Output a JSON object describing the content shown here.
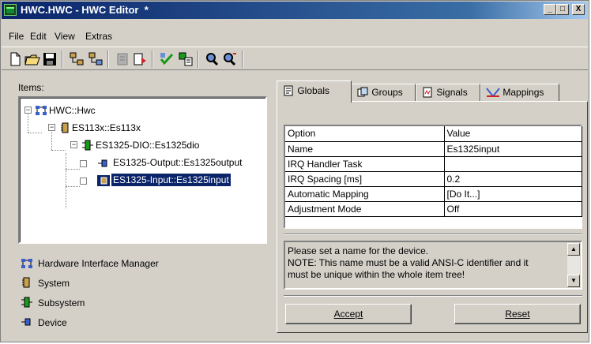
{
  "window": {
    "title": "HWC.HWC - HWC Editor  *",
    "minimize": "_",
    "maximize": "□",
    "close": "X"
  },
  "menu": [
    "File",
    "Edit",
    "View",
    "Extras"
  ],
  "left": {
    "items_label": "Items:",
    "tree": [
      {
        "label": "HWC::Hwc",
        "expander": "−",
        "icon": "hardware-manager-icon"
      },
      {
        "label": "ES113x::Es113x",
        "expander": "−",
        "icon": "system-icon"
      },
      {
        "label": "ES1325-DIO::Es1325dio",
        "expander": "−",
        "icon": "subsystem-icon"
      },
      {
        "label": "ES1325-Output::Es1325output",
        "expander": "",
        "icon": "device-icon"
      },
      {
        "label": "ES1325-Input::Es1325input",
        "expander": "",
        "icon": "device-icon"
      }
    ],
    "legend": [
      {
        "label": "Hardware Interface Manager",
        "icon": "hardware-manager-icon"
      },
      {
        "label": "System",
        "icon": "system-icon"
      },
      {
        "label": "Subsystem",
        "icon": "subsystem-icon"
      },
      {
        "label": "Device",
        "icon": "device-icon"
      }
    ]
  },
  "tabs": [
    {
      "label": "Globals",
      "icon": "globals-icon",
      "active": true
    },
    {
      "label": "Groups",
      "icon": "groups-icon",
      "active": false
    },
    {
      "label": "Signals",
      "icon": "signals-icon",
      "active": false
    },
    {
      "label": "Mappings",
      "icon": "mappings-icon",
      "active": false
    }
  ],
  "grid": {
    "headers": [
      "Option",
      "Value"
    ],
    "rows": [
      [
        "Name",
        "Es1325input"
      ],
      [
        "IRQ Handler Task",
        ""
      ],
      [
        "IRQ Spacing [ms]",
        "0.2"
      ],
      [
        "Automatic Mapping",
        "[Do It...]"
      ],
      [
        "Adjustment Mode",
        "Off"
      ]
    ]
  },
  "description": {
    "line1": "Please set a name for the device.",
    "line2": "NOTE: This name must be a valid ANSI-C identifier and it",
    "line3": "must be unique within the whole item tree!"
  },
  "buttons": {
    "accept": "Accept",
    "reset": "Reset"
  },
  "colors": {
    "titlebar": "#0a246a",
    "selection": "#0a246a",
    "face": "#d4d0c8"
  }
}
